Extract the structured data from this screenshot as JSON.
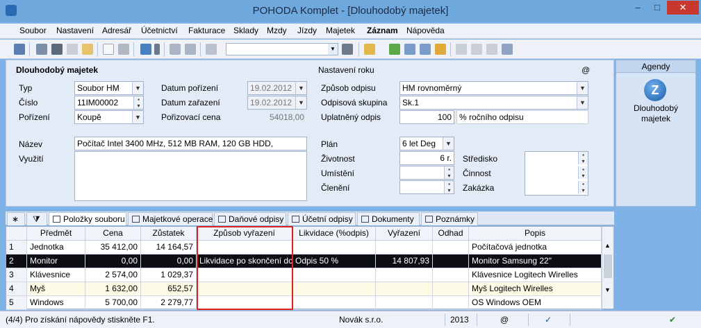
{
  "window": {
    "title": "POHODA Komplet - [Dlouhodobý majetek]",
    "minimize": "–",
    "maximize": "□",
    "close": "✕"
  },
  "menu": [
    "Soubor",
    "Nastavení",
    "Adresář",
    "Účetnictví",
    "Fakturace",
    "Sklady",
    "Mzdy",
    "Jízdy",
    "Majetek",
    "Záznam",
    "Nápověda"
  ],
  "form": {
    "section_title": "Dlouhodobý majetek",
    "typ_label": "Typ",
    "typ_value": "Soubor HM",
    "cislo_label": "Číslo",
    "cislo_value": "11IM00002",
    "porizeni_label": "Pořízení",
    "porizeni_value": "Koupě",
    "datum_porizeni_label": "Datum pořízení",
    "datum_porizeni_value": "19.02.2012",
    "datum_zarazeni_label": "Datum zařazení",
    "datum_zarazeni_value": "19.02.2012",
    "porizovaci_cena_label": "Pořizovací cena",
    "porizovaci_cena_value": "54018,00",
    "nazev_label": "Název",
    "nazev_value": "Počítač Intel 3400 MHz, 512 MB RAM, 120 GB HDD,",
    "vyuziti_label": "Využití",
    "nastaveni_title": "Nastavení roku",
    "at_sign": "@",
    "zpusob_odpisu_label": "Způsob odpisu",
    "zpusob_odpisu_value": "HM rovnoměrný",
    "odpisova_skupina_label": "Odpisová skupina",
    "odpisova_skupina_value": "Sk.1",
    "uplatneny_odpis_label": "Uplatněný odpis",
    "uplatneny_odpis_value": "100",
    "rocniho_odpisu_label": "% ročního odpisu",
    "plan_label": "Plán",
    "plan_value": "6 let Deg",
    "zivotnost_label": "Životnost",
    "zivotnost_value": "6 r.",
    "umisteni_label": "Umístění",
    "cleneni_label": "Členění",
    "stredisko_label": "Středisko",
    "cinnost_label": "Činnost",
    "zakazka_label": "Zakázka"
  },
  "agendy": {
    "header": "Agendy",
    "item_label_1": "Dlouhodobý",
    "item_label_2": "majetek"
  },
  "tabs": [
    "Položky souboru",
    "Majetkové operace",
    "Daňové odpisy",
    "Účetní odpisy",
    "Dokumenty",
    "Poznámky"
  ],
  "grid": {
    "columns": [
      "",
      "Předmět",
      "Cena",
      "Zůstatek",
      "Způsob vyřazení",
      "Likvidace (%odpis)",
      "Vyřazení",
      "Odhad",
      "Popis"
    ],
    "rows": [
      [
        "1",
        "Jednotka",
        "35 412,00",
        "14 164,57",
        "",
        "",
        "",
        "",
        "Počítačová jednotka"
      ],
      [
        "2",
        "Monitor",
        "0,00",
        "0,00",
        "Likvidace po skončení dc",
        "Odpis 50 %",
        "14 807,93",
        "",
        "Monitor Samsung 22\""
      ],
      [
        "3",
        "Klávesnice",
        "2 574,00",
        "1 029,37",
        "",
        "",
        "",
        "",
        "Klávesnice Logitech Wirelles"
      ],
      [
        "4",
        "Myš",
        "1 632,00",
        "652,57",
        "",
        "",
        "",
        "",
        "Myš Logitech Wirelles"
      ],
      [
        "5",
        "Windows",
        "5 700,00",
        "2 279,77",
        "",
        "",
        "",
        "",
        "OS Windows OEM"
      ]
    ]
  },
  "status": {
    "count": "(4/4) Pro získání nápovědy stiskněte F1.",
    "company": "Novák  s.r.o.",
    "year": "2013",
    "at": "@"
  }
}
